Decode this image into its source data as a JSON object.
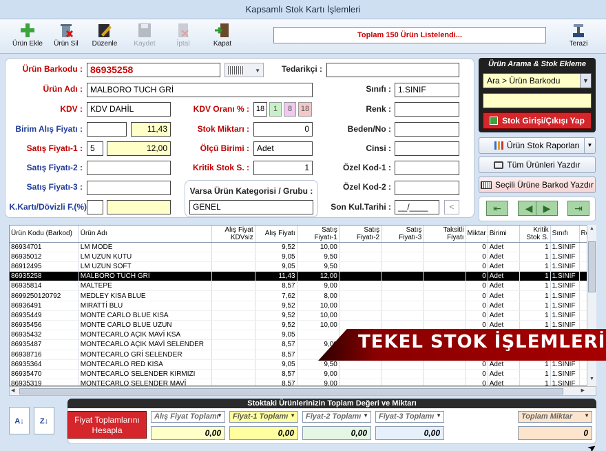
{
  "window": {
    "title": "Kapsamlı Stok Kartı İşlemleri"
  },
  "toolbar": {
    "add": "Ürün Ekle",
    "delete": "Ürün Sil",
    "edit": "Düzenle",
    "save": "Kaydet",
    "cancel": "İptal",
    "close": "Kapat",
    "scale": "Terazi",
    "status": "Toplam 150 Ürün Listelendi..."
  },
  "form": {
    "barcode_label": "Ürün Barkodu :",
    "barcode_value": "86935258",
    "name_label": "Ürün Adı :",
    "name_value": "MALBORO TUCH GRİ",
    "kdv_label": "KDV :",
    "kdv_value": "KDV DAHİL",
    "buy_label": "Birim Alış Fiyatı :",
    "buy_value": "11,43",
    "sell1_label": "Satış Fiyatı-1 :",
    "sell1_prefix": "5",
    "sell1_value": "12,00",
    "sell2_label": "Satış Fiyatı-2 :",
    "sell3_label": "Satış Fiyatı-3 :",
    "fx_label": "K.Kartı/Dövizli F.(%)",
    "kdvrate_label": "KDV Oranı % :",
    "kdvrates": [
      "18",
      "1",
      "8",
      "18"
    ],
    "stock_label": "Stok Miktarı :",
    "stock_value": "0",
    "unit_label": "Ölçü Birimi :",
    "unit_value": "Adet",
    "critical_label": "Kritik Stok S. :",
    "critical_value": "1",
    "category_label": "Varsa Ürün Kategorisi / Grubu :",
    "category_value": "GENEL",
    "supplier_label": "Tedarikçi :",
    "class_label": "Sınıfı :",
    "class_value": "1.SINIF",
    "color_label": "Renk :",
    "size_label": "Beden/No :",
    "type_label": "Cinsi :",
    "code1_label": "Özel Kod-1 :",
    "code2_label": "Özel Kod-2 :",
    "lastuse_label": "Son Kul.Tarihi :",
    "lastuse_value": "__/____"
  },
  "search_panel": {
    "title": "Ürün Arama & Stok Ekleme",
    "select_value": "Ara > Ürün Barkodu",
    "stock_button": "Stok Girişi/Çıkışı Yap"
  },
  "side_buttons": {
    "reports": "Ürün Stok Raporları",
    "print_all": "Tüm Ürünleri Yazdır",
    "print_barcode": "Seçili Ürüne Barkod Yazdır"
  },
  "grid": {
    "columns": [
      "Ürün Kodu (Barkod)",
      "Ürün Adı",
      "Alış Fiyat KDVsiz",
      "Alış Fiyatı",
      "Satış Fiyatı-1",
      "Satış Fiyatı-2",
      "Satış Fiyatı-3",
      "Taksitli Fiyatı",
      "Miktar",
      "Birimi",
      "Kritik Stok S.",
      "Sınıfı",
      "Ren"
    ],
    "rows": [
      [
        "86934701",
        "LM MODE",
        "",
        "9,52",
        "10,00",
        "",
        "",
        "",
        "0",
        "Adet",
        "1",
        "1.SINIF"
      ],
      [
        "86935012",
        "LM UZUN KUTU",
        "",
        "9,05",
        "9,50",
        "",
        "",
        "",
        "0",
        "Adet",
        "1",
        "1.SINIF"
      ],
      [
        "86912495",
        "LM UZUN SOFT",
        "",
        "9,05",
        "9,50",
        "",
        "",
        "",
        "0",
        "Adet",
        "1",
        "1.SINIF"
      ],
      [
        "86935258",
        "MALBORO TUCH GRİ",
        "",
        "11,43",
        "12,00",
        "",
        "",
        "",
        "0",
        "Adet",
        "1",
        "1.SINIF"
      ],
      [
        "86935814",
        "MALTEPE",
        "",
        "8,57",
        "9,00",
        "",
        "",
        "",
        "0",
        "Adet",
        "1",
        "1.SINIF"
      ],
      [
        "8699250120792",
        "MEDLEY KISA BLUE",
        "",
        "7,62",
        "8,00",
        "",
        "",
        "",
        "0",
        "Adet",
        "1",
        "1.SINIF"
      ],
      [
        "86936491",
        "MIRATTİ BLU",
        "",
        "9,52",
        "10,00",
        "",
        "",
        "",
        "0",
        "Adet",
        "1",
        "1.SINIF"
      ],
      [
        "86935449",
        "MONTE CARLO BLUE KISA",
        "",
        "9,52",
        "10,00",
        "",
        "",
        "",
        "0",
        "Adet",
        "1",
        "1.SINIF"
      ],
      [
        "86935456",
        "MONTE CARLO BLUE UZUN",
        "",
        "9,52",
        "10,00",
        "",
        "",
        "",
        "0",
        "Adet",
        "1",
        "1.SINIF"
      ],
      [
        "86935432",
        "MONTECARLO AÇIK MAVİ KSA",
        "",
        "9,05",
        "",
        "",
        "",
        "",
        "",
        "",
        "",
        ""
      ],
      [
        "86935487",
        "MONTECARLO AÇIK MAVİ SELENDER",
        "",
        "8,57",
        "9,00",
        "",
        "",
        "",
        "",
        "",
        "",
        ""
      ],
      [
        "86938716",
        "MONTECARLO GRİ SELENDER",
        "",
        "8,57",
        "",
        "",
        "",
        "",
        "",
        "",
        "",
        ""
      ],
      [
        "86935364",
        "MONTECARLO RED KISA",
        "",
        "9,05",
        "9,50",
        "",
        "",
        "",
        "0",
        "Adet",
        "1",
        "1.SINIF"
      ],
      [
        "86935470",
        "MONTECARLO SELENDER KIRMIZI",
        "",
        "8,57",
        "9,00",
        "",
        "",
        "",
        "0",
        "Adet",
        "1",
        "1.SINIF"
      ],
      [
        "86935319",
        "MONTECARLO SELENDER MAVİ",
        "",
        "8,57",
        "9,00",
        "",
        "",
        "",
        "0",
        "Adet",
        "1",
        "1.SINIF"
      ]
    ],
    "selected_index": 3
  },
  "banner": {
    "text": "TEKEL STOK İŞLEMLERİ"
  },
  "totals": {
    "title": "Stoktaki Ürünlerinizin Toplam Değeri ve Miktarı",
    "calc_button": "Fiyat Toplamlarını Hesapla",
    "buy_label": "Alış Fiyat Toplamı",
    "buy_value": "0,00",
    "p1_label": "Fiyat-1 Toplamı",
    "p1_value": "0,00",
    "p2_label": "Fiyat-2 Toplamı",
    "p2_value": "0,00",
    "p3_label": "Fiyat-3 Toplamı",
    "p3_value": "0,00",
    "qty_label": "Toplam Miktar",
    "qty_value": "0"
  }
}
